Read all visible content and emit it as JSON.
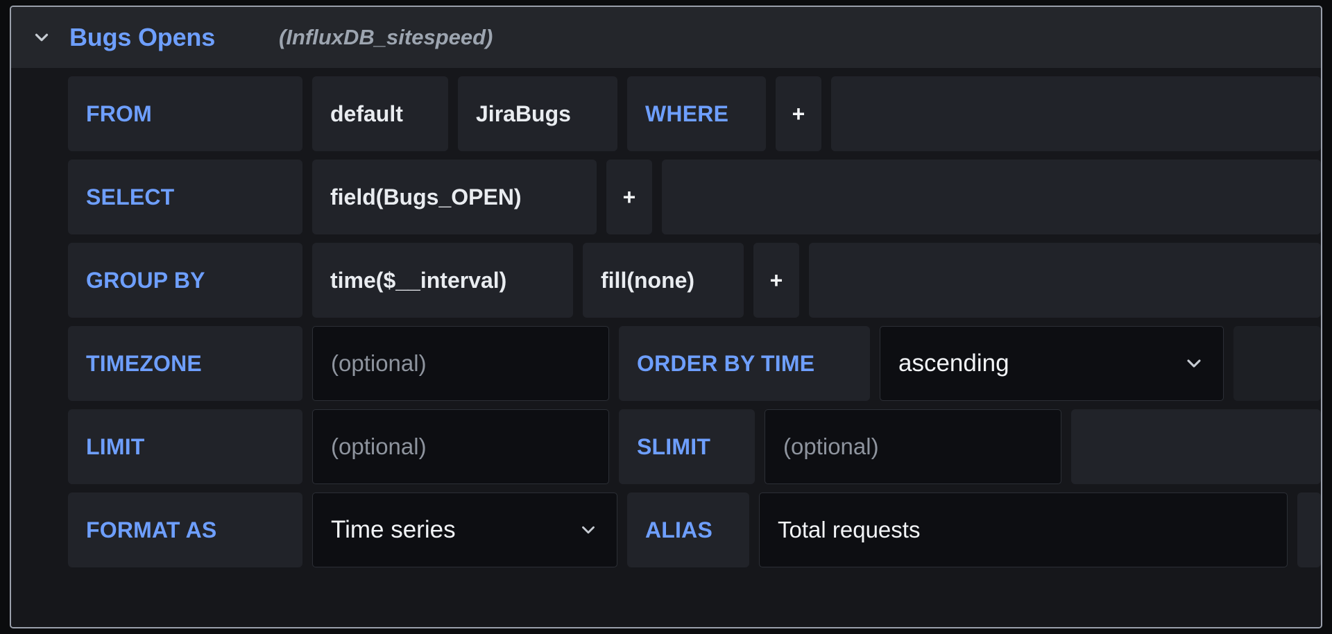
{
  "panel": {
    "title": "Bugs Opens",
    "datasource": "(InfluxDB_sitespeed)",
    "collapse_icon": "chevron-down-icon",
    "accent_color": "#6e9fff",
    "background_color": "#16171b",
    "header_background": "#24262b"
  },
  "rows": {
    "from": {
      "label": "FROM",
      "policy": "default",
      "measurement": "JiraBugs",
      "where_label": "WHERE",
      "add_label": "+"
    },
    "select": {
      "label": "SELECT",
      "field": "field(Bugs_OPEN)",
      "add_label": "+"
    },
    "group_by": {
      "label": "GROUP BY",
      "time": "time($__interval)",
      "fill": "fill(none)",
      "add_label": "+"
    },
    "timezone": {
      "label": "TIMEZONE",
      "placeholder": "(optional)",
      "value": "",
      "order_by_label": "ORDER BY TIME",
      "order_by_value": "ascending",
      "order_by_icon": "chevron-down-icon"
    },
    "limit": {
      "label": "LIMIT",
      "placeholder": "(optional)",
      "value": "",
      "slimit_label": "SLIMIT",
      "slimit_placeholder": "(optional)",
      "slimit_value": ""
    },
    "format": {
      "label": "FORMAT AS",
      "value": "Time series",
      "icon": "chevron-down-icon",
      "alias_label": "ALIAS",
      "alias_value": "Total requests"
    }
  }
}
